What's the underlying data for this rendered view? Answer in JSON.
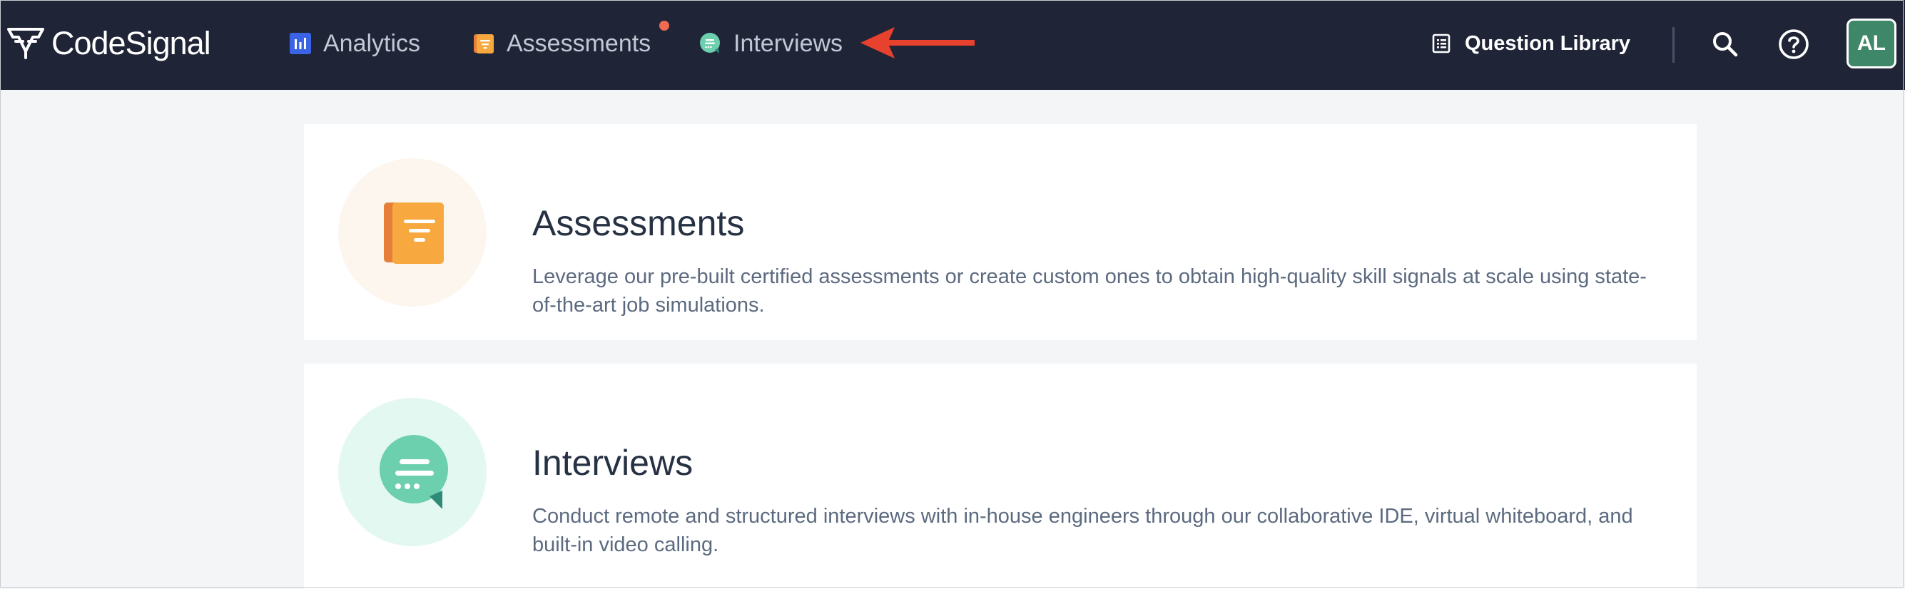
{
  "brand": {
    "name": "CodeSignal"
  },
  "nav": {
    "items": [
      {
        "label": "Analytics",
        "icon": "analytics-icon"
      },
      {
        "label": "Assessments",
        "icon": "assessments-icon",
        "has_notification": true
      },
      {
        "label": "Interviews",
        "icon": "interviews-icon"
      }
    ],
    "question_library": "Question Library",
    "avatar_initials": "AL"
  },
  "cards": [
    {
      "title": "Assessments",
      "description": "Leverage our pre-built certified assessments or create custom ones to obtain high-quality skill signals at scale using state-of-the-art job simulations.",
      "icon": "assessments-icon"
    },
    {
      "title": "Interviews",
      "description": "Conduct remote and structured interviews with in-house engineers through our collaborative IDE, virtual whiteboard, and built-in video calling.",
      "icon": "interviews-icon"
    }
  ],
  "colors": {
    "nav_bg": "#1f2437",
    "page_bg": "#f4f5f7",
    "notification": "#f06b52",
    "arrow": "#e8412d",
    "avatar_bg": "#3e8768",
    "assessments_orange": "#f7a83e",
    "interviews_teal": "#6ccfae"
  }
}
